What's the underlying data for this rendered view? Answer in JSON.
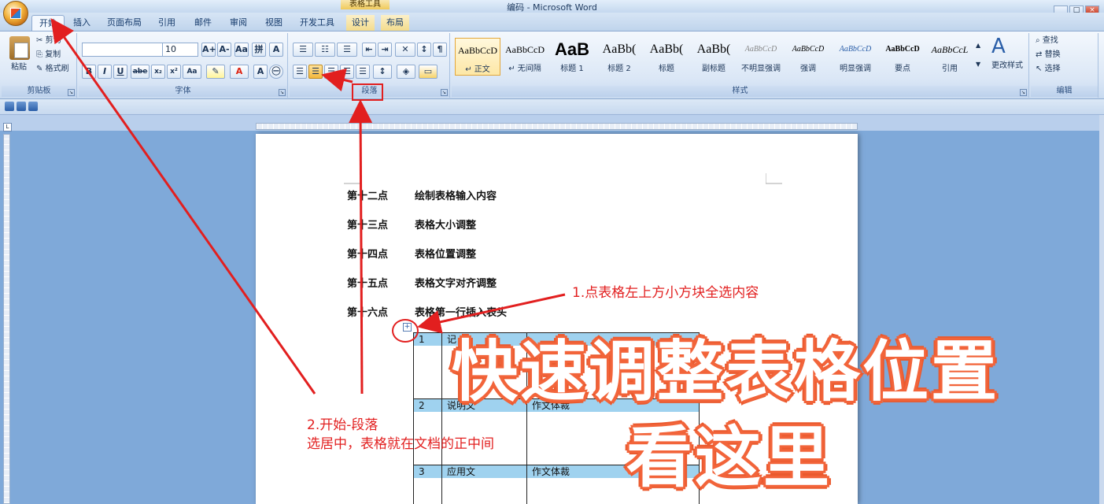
{
  "window": {
    "title": "编码 - Microsoft Word",
    "context_tab_group": "表格工具",
    "controls": [
      "_",
      "□",
      "×"
    ]
  },
  "tabs": [
    {
      "label": "开始",
      "active": true
    },
    {
      "label": "插入"
    },
    {
      "label": "页面布局"
    },
    {
      "label": "引用"
    },
    {
      "label": "邮件"
    },
    {
      "label": "审阅"
    },
    {
      "label": "视图"
    },
    {
      "label": "开发工具"
    },
    {
      "label": "设计"
    },
    {
      "label": "布局"
    }
  ],
  "ribbon": {
    "clipboard": {
      "paste": "粘贴",
      "cut": "剪切",
      "copy": "复制",
      "format_painter": "格式刷",
      "label": "剪贴板"
    },
    "font": {
      "font_name": "",
      "font_size": "10",
      "label": "字体",
      "buttons": [
        "A+",
        "A-",
        "Aa",
        "B",
        "I",
        "U",
        "abe",
        "x₂",
        "x²",
        "Aa",
        "A",
        "A"
      ]
    },
    "paragraph": {
      "label": "段落"
    },
    "styles": {
      "label": "样式",
      "change_styles": "更改样式",
      "tiles": [
        {
          "preview": "AaBbCcD",
          "name": "↵ 正文",
          "selected": true
        },
        {
          "preview": "AaBbCcD",
          "name": "↵ 无间隔"
        },
        {
          "preview": "AaB",
          "name": "标题 1"
        },
        {
          "preview": "AaBb(",
          "name": "标题 2"
        },
        {
          "preview": "AaBb(",
          "name": "标题"
        },
        {
          "preview": "AaBb(",
          "name": "副标题"
        },
        {
          "preview": "AaBbCcD",
          "name": "不明显强调"
        },
        {
          "preview": "AaBbCcD",
          "name": "强调"
        },
        {
          "preview": "AaBbCcD",
          "name": "明显强调"
        },
        {
          "preview": "AaBbCcD",
          "name": "要点"
        },
        {
          "preview": "AaBbCcL",
          "name": "引用"
        }
      ]
    },
    "editing": {
      "label": "编辑",
      "find": "查找",
      "replace": "替换",
      "select": "选择"
    }
  },
  "document": {
    "lines": [
      {
        "num": "第十二点",
        "text": "绘制表格输入内容"
      },
      {
        "num": "第十三点",
        "text": "表格大小调整"
      },
      {
        "num": "第十四点",
        "text": "表格位置调整"
      },
      {
        "num": "第十五点",
        "text": "表格文字对齐调整"
      },
      {
        "num": "第十六点",
        "text": "表格第一行插入表头"
      }
    ],
    "table": {
      "rows": [
        {
          "no": "1",
          "col2": "记",
          "col3": ""
        },
        {
          "no": "2",
          "col2": "说明文",
          "col3": "作文体裁"
        },
        {
          "no": "3",
          "col2": "应用文",
          "col3": "作文体裁"
        }
      ],
      "handle_icon": "move-handle-icon"
    }
  },
  "annotations": {
    "note1": "1.点表格左上方小方块全选内容",
    "note2_line1": "2.开始-段落",
    "note2_line2": "选居中，表格就在文档的正中间",
    "overlay_line1": "快速调整表格位置",
    "overlay_line2": "看这里",
    "color": "#e21f1f"
  }
}
